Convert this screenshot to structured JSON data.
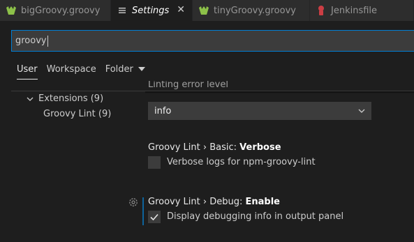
{
  "tabs": [
    {
      "label": "bigGroovy.groovy",
      "icon": "groovy-file-icon",
      "active": false
    },
    {
      "label": "Settings",
      "icon": "settings-lines-icon",
      "active": true
    },
    {
      "label": "tinyGroovy.groovy",
      "icon": "groovy-file-icon",
      "active": false
    },
    {
      "label": "Jenkinsfile",
      "icon": "jenkins-file-icon",
      "active": false
    }
  ],
  "search": {
    "value": "groovy"
  },
  "scope_tabs": {
    "user": "User",
    "workspace": "Workspace",
    "folder": "Folder"
  },
  "tree": {
    "extensions": "Extensions (9)",
    "groovy_lint": "Groovy Lint (9)"
  },
  "settings": {
    "partial_title": "Linting error level",
    "linting_level": {
      "value": "info"
    },
    "verbose": {
      "prefix": "Groovy Lint › Basic: ",
      "name": "Verbose",
      "description": "Verbose logs for npm-groovy-lint",
      "checked": false
    },
    "debug_enable": {
      "prefix": "Groovy Lint › Debug: ",
      "name": "Enable",
      "description": "Display debugging info in output panel",
      "checked": true
    }
  },
  "colors": {
    "accent": "#007fd4",
    "groovy_icon": "#8dc149",
    "jenkins_icon": "#cc3e44"
  }
}
